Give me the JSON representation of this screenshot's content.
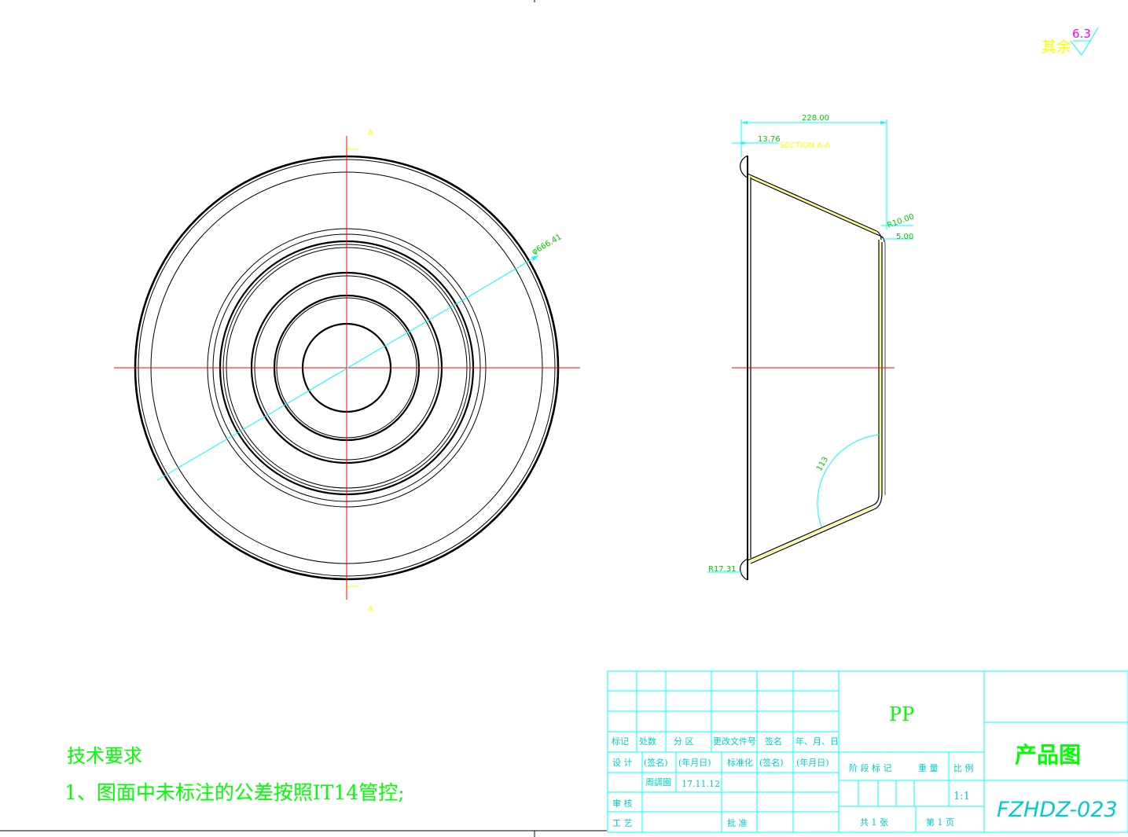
{
  "roughness": {
    "label": "其余",
    "value": "6.3"
  },
  "front_view": {
    "section_mark_top": "A",
    "section_mark_bottom": "A",
    "dim_diameter": "φ666.41"
  },
  "section_view": {
    "title": "SECTION  A-A",
    "dim_width": "228.00",
    "dim_lip": "13.76",
    "dim_radius_top": "R10.00",
    "dim_thickness": "5.00",
    "dim_angle": "113",
    "dim_radius_bottom": "R17.31"
  },
  "tech_requirements": {
    "heading": "技术要求",
    "item1": "1、图面中未标注的公差按照IT14管控;"
  },
  "title_block": {
    "material": "PP",
    "drawing_name": "产品图",
    "drawing_number": "FZHDZ-023",
    "rev_headers": [
      "标记",
      "处数",
      "分 区",
      "更改文件号",
      "签名",
      "年、月、日"
    ],
    "design_label": "设 计",
    "sign_placeholder_1": "(签名)",
    "date_placeholder_1": "(年月日)",
    "standardization_label": "标准化",
    "sign_placeholder_2": "(签名)",
    "date_placeholder_2": "(年月日)",
    "designer": "周調園",
    "design_date": "17.11.12",
    "review_label": "审 核",
    "process_label": "工 艺",
    "approve_label": "批 准",
    "stage_label": "阶 段 标 记",
    "weight_label": "重 量",
    "scale_label": "比 例",
    "scale_value": "1:1",
    "sheets_total_label": "共 1 张",
    "sheet_no_label": "第 1 页"
  },
  "colors": {
    "background": "#ffffff",
    "outline": "#000000",
    "center_line": "#ff0000",
    "dimension": "#00ffff",
    "dim_text": "#00cc00",
    "annotation": "#ffff00",
    "roughness_value": "#ff00ff",
    "tech_text": "#00ff00"
  }
}
